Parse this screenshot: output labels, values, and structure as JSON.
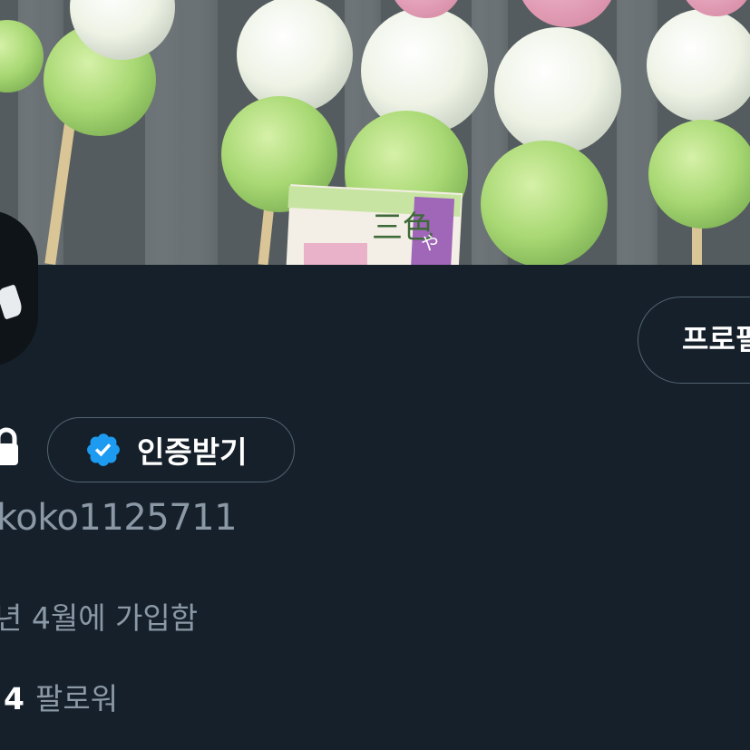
{
  "banner": {
    "label_text": "三色",
    "label_sub": "や"
  },
  "profile": {
    "edit_button_label": "프로필 수정",
    "verify_button_label": "인증받기",
    "handle": "koko1125711",
    "joined": "년 4월에 가입함",
    "following_count": "4",
    "following_label": "팔로워"
  },
  "icons": [
    "lock-icon",
    "verified-badge-icon"
  ],
  "colors": {
    "background": "#15202b",
    "secondary_text": "#8b98a5",
    "border": "#536471",
    "verified_blue": "#1d9bf0"
  }
}
